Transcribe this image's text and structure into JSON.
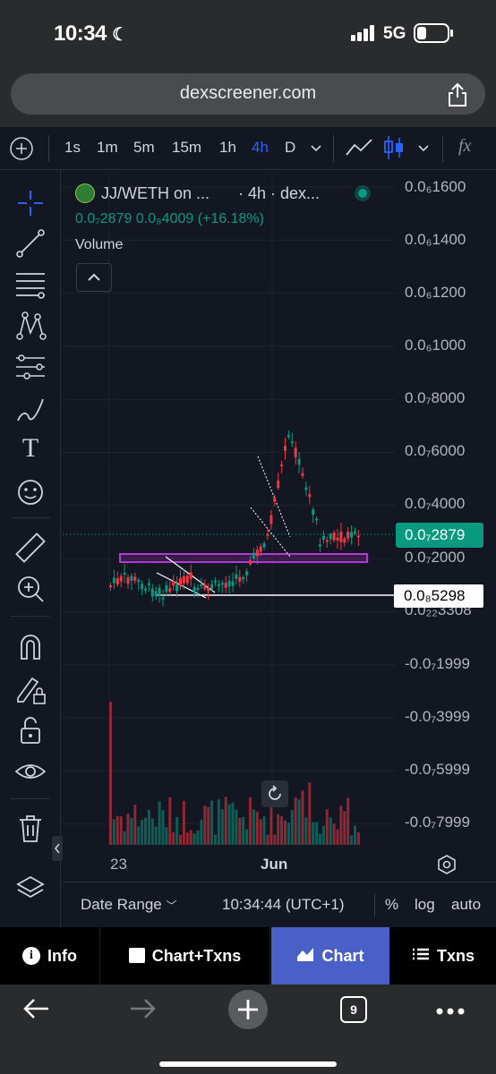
{
  "status": {
    "time": "10:34",
    "network": "5G"
  },
  "browser": {
    "url": "dexscreener.com",
    "tab_count": "9"
  },
  "toolbar": {
    "timeframes": [
      "1s",
      "1m",
      "5m",
      "15m",
      "1h",
      "4h",
      "D"
    ],
    "active_timeframe": "4h",
    "function_label": "fx"
  },
  "legend": {
    "pair_title": "JJ/WETH on ...",
    "interval_source": "· 4h · dex...",
    "price": "0.0₇2879",
    "change_abs": "0.0₈4009",
    "change_pct": "(+16.18%)",
    "volume_label": "Volume"
  },
  "price_axis": {
    "labels": [
      "0.0₆1600",
      "0.0₆1400",
      "0.0₆1200",
      "0.0₆1000",
      "0.0₇8000",
      "0.0₇6000",
      "0.0₇4000",
      "0.0₇2000",
      "0.0₂₂3308",
      "-0.0₇1999",
      "-0.0₇3999",
      "-0.0₇5999",
      "-0.0₇7999"
    ],
    "current_price_tag": "0.0₇2879",
    "horizontal_line_tag": "0.0₈5298",
    "current_color": "#089981"
  },
  "time_axis": {
    "labels": [
      "23",
      "Jun"
    ]
  },
  "date_bar": {
    "date_range_label": "Date Range",
    "clock": "10:34:44 (UTC+1)",
    "percent": "%",
    "log": "log",
    "auto": "auto"
  },
  "tabs": [
    {
      "label": "Info",
      "icon": "info-icon",
      "active": false
    },
    {
      "label": "Chart+Txns",
      "icon": "split-view-icon",
      "active": false
    },
    {
      "label": "Chart",
      "icon": "chart-icon",
      "active": true
    },
    {
      "label": "Txns",
      "icon": "list-icon",
      "active": false
    }
  ],
  "colors": {
    "up": "#089981",
    "down": "#f23645",
    "zone": "#9c27b0",
    "accent": "#2962ff",
    "active_tab": "#4b5fc9"
  }
}
